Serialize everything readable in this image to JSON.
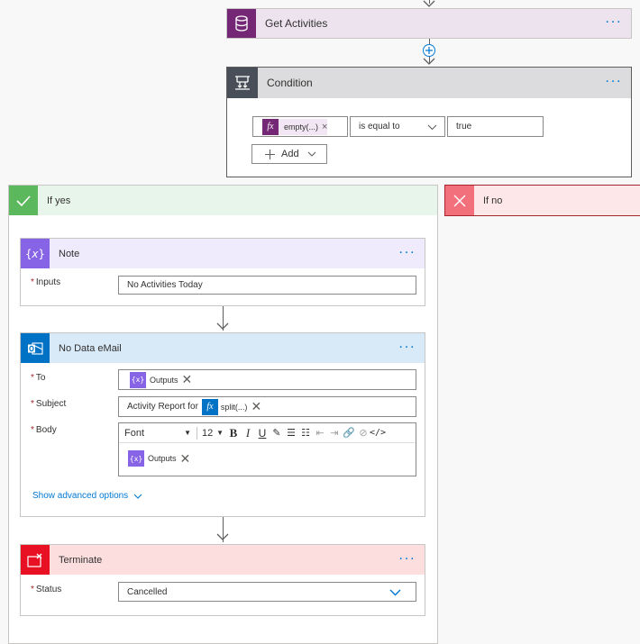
{
  "get_activities": {
    "title": "Get Activities",
    "more": "···"
  },
  "condition": {
    "title": "Condition",
    "more": "···",
    "left_token": "empty(...)",
    "operator": "is equal to",
    "right_value": "true",
    "add_label": "Add"
  },
  "if_yes": {
    "title": "If yes"
  },
  "if_no": {
    "title": "If no"
  },
  "note": {
    "title": "Note",
    "more": "···",
    "inputs_label": "Inputs",
    "inputs_value": "No Activities Today"
  },
  "email": {
    "title": "No Data eMail",
    "more": "···",
    "to_label": "To",
    "to_token": "Outputs",
    "subject_label": "Subject",
    "subject_text": "Activity Report for",
    "subject_token": "split(...)",
    "body_label": "Body",
    "font_value": "Font",
    "font_size": "12",
    "body_token": "Outputs",
    "advanced_link": "Show advanced options"
  },
  "terminate": {
    "title": "Terminate",
    "more": "···",
    "status_label": "Status",
    "status_value": "Cancelled"
  },
  "colors": {
    "accent": "#0078d4",
    "get_activities_header": "#ece3ef",
    "get_activities_icon": "#742774",
    "condition_header": "#dcdcde",
    "condition_icon": "#484f58",
    "yes_header": "#e8f5ea",
    "yes_icon": "#5cb85c",
    "no_header": "#fde7e9",
    "no_icon": "#f1707b",
    "note_header": "#efeafc",
    "note_icon": "#8764e6",
    "email_header": "#d8e9f7",
    "email_icon": "#0072c6",
    "terminate_header": "#fddedf",
    "terminate_icon": "#e81123"
  }
}
